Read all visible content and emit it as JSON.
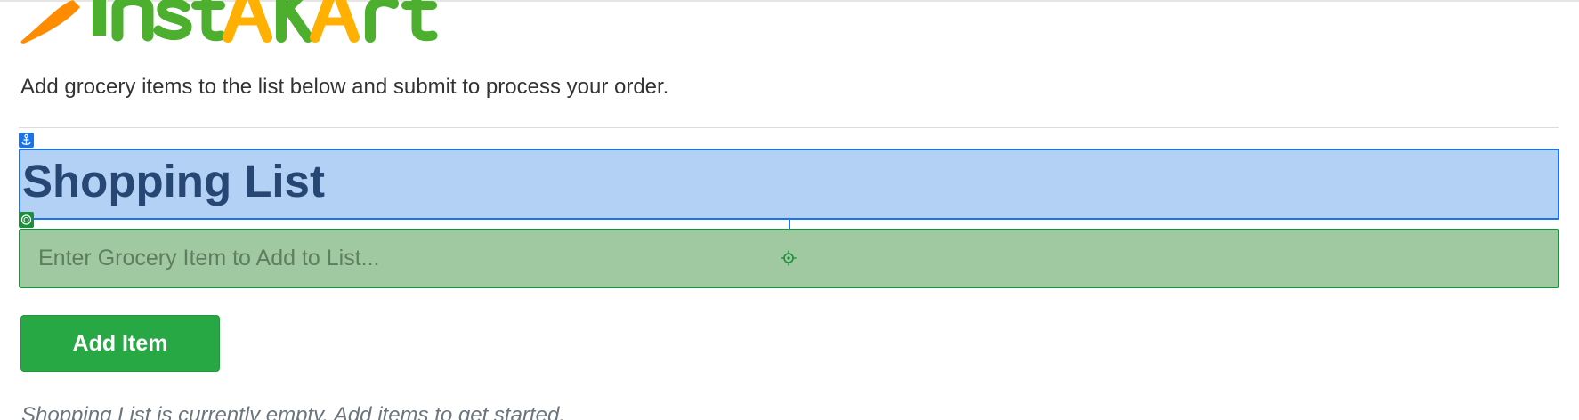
{
  "header": {
    "logo": {
      "text": "InstAKArt",
      "colors": {
        "carrot": "#ff8c00",
        "green": "#4caf2e",
        "orange_letters": "#ffb000"
      }
    }
  },
  "main": {
    "intro_text": "Add grocery items to the list below and submit to process your order.",
    "heading": "Shopping List",
    "input": {
      "value": "",
      "placeholder": "Enter Grocery Item to Add to List..."
    },
    "add_button_label": "Add Item",
    "empty_message": "Shopping List is currently empty. Add items to get started."
  },
  "overlays": {
    "heading_badge_icon": "anchor-icon",
    "input_badge_icon": "target-icon",
    "input_center_icon": "crosshair-icon",
    "colors": {
      "heading_highlight": "#b3d1f5",
      "heading_border": "#1a73e8",
      "input_highlight": "#a1c9a1",
      "input_border": "#1e8e3e"
    }
  },
  "colors": {
    "button_bg": "#28a745",
    "heading_text": "#264673"
  }
}
